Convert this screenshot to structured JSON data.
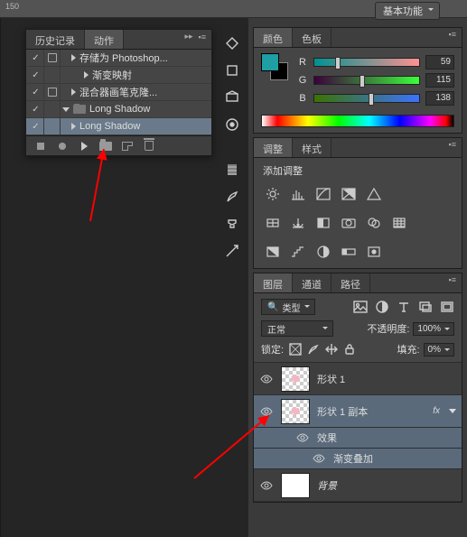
{
  "workspace": {
    "label": "基本功能"
  },
  "ruler": {
    "tick": "150"
  },
  "actions_panel": {
    "tabs": {
      "history": "历史记录",
      "actions": "动作"
    },
    "rows": [
      {
        "label": "存储为 Photoshop...",
        "checked": true,
        "dialog": true,
        "expand": "right",
        "indent": 1
      },
      {
        "label": "渐变映射",
        "checked": true,
        "expand": "right",
        "indent": 2
      },
      {
        "label": "混合器画笔克隆...",
        "checked": true,
        "dialog": true,
        "expand": "right",
        "indent": 1
      },
      {
        "label": "Long Shadow",
        "checked": true,
        "expand": "down",
        "folder": true,
        "indent": 0
      },
      {
        "label": "Long Shadow",
        "checked": true,
        "expand": "right",
        "indent": 1,
        "selected": true
      }
    ]
  },
  "color_panel": {
    "tabs": {
      "color": "颜色",
      "swatches": "色板"
    },
    "sliders": {
      "r": 59,
      "g": 115,
      "b": 138
    }
  },
  "adjustments_panel": {
    "tabs": {
      "adjust": "调整",
      "styles": "样式"
    },
    "title": "添加调整"
  },
  "layers_panel": {
    "tabs": {
      "layers": "图层",
      "channels": "通道",
      "paths": "路径"
    },
    "filter_label": "类型",
    "blend_mode": "正常",
    "opacity_label": "不透明度:",
    "opacity_value": "100%",
    "lock_label": "锁定:",
    "fill_label": "填充:",
    "fill_value": "0%",
    "layers": [
      {
        "name": "形状 1"
      },
      {
        "name": "形状 1 副本",
        "selected": true,
        "fx": "fx"
      },
      {
        "name": "背景",
        "italic": true
      }
    ],
    "fx_group": "效果",
    "fx_item": "渐变叠加"
  }
}
